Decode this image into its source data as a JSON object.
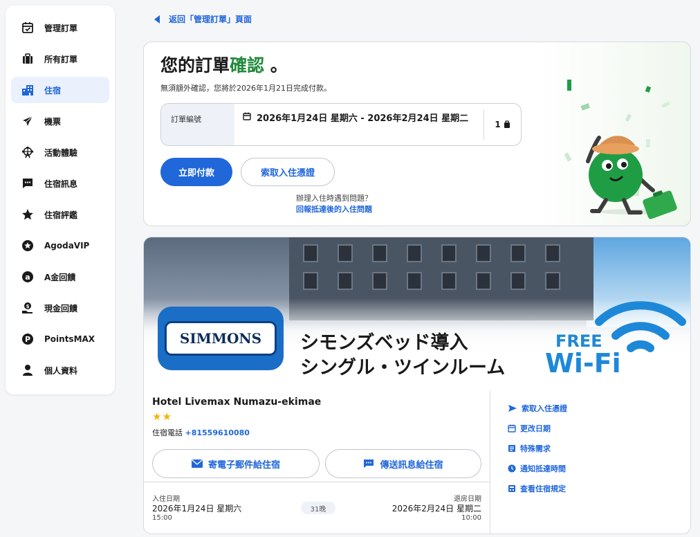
{
  "sidebar": {
    "items": [
      {
        "label": "管理訂單",
        "icon": "calendar-check-icon"
      },
      {
        "label": "所有訂單",
        "icon": "suitcase-icon"
      },
      {
        "label": "住宿",
        "icon": "building-icon",
        "active": true
      },
      {
        "label": "機票",
        "icon": "airplane-icon"
      },
      {
        "label": "活動體驗",
        "icon": "ferris-wheel-icon"
      },
      {
        "label": "住宿訊息",
        "icon": "chat-icon"
      },
      {
        "label": "住宿評鑑",
        "icon": "star-icon"
      },
      {
        "label": "AgodaVIP",
        "icon": "vip-star-icon"
      },
      {
        "label": "A金回饋",
        "icon": "agoda-cash-icon"
      },
      {
        "label": "現金回饋",
        "icon": "cashback-icon"
      },
      {
        "label": "PointsMAX",
        "icon": "pointsmax-icon"
      },
      {
        "label": "個人資料",
        "icon": "person-icon"
      }
    ]
  },
  "back_link": "返回「管理訂單」頁面",
  "confirm": {
    "title_prefix": "您的訂單",
    "title_highlight": "確認",
    "title_suffix": "。",
    "subtitle": "無須額外確認，您將於2026年1月21日完成付款。",
    "booking_label": "訂單編號",
    "dates": "2026年1月24日 星期六 - 2026年2月24日 星期二",
    "guests": "1",
    "pay_button": "立即付款",
    "voucher_button": "索取入住憑證",
    "help_question": "辦理入住時遇到問題？",
    "help_link": "回報抵達後的入住問題"
  },
  "hotel": {
    "banner_brand": "SIMMONS",
    "banner_line1": "シモンズベッド導入",
    "banner_line2": "シングル・ツインルーム",
    "banner_free": "FREE",
    "banner_wifi": "Wi-Fi",
    "name": "Hotel Livemax Numazu-ekimae",
    "stars": "★★",
    "star_rating": 2,
    "phone_label": "住宿電話",
    "phone_number": "+81559610080",
    "email_button": "寄電子郵件給住宿",
    "message_button": "傳送訊息給住宿",
    "checkin_label": "入住日期",
    "checkin_date": "2026年1月24日 星期六",
    "checkin_time": "15:00",
    "nights": "31晚",
    "checkout_label": "退房日期",
    "checkout_date": "2026年2月24日 星期二",
    "checkout_time": "10:00",
    "actions": [
      {
        "label": "索取入住憑證",
        "icon": "send-icon"
      },
      {
        "label": "更改日期",
        "icon": "calendar-icon"
      },
      {
        "label": "特殊需求",
        "icon": "request-icon"
      },
      {
        "label": "通知抵達時間",
        "icon": "clock-icon"
      },
      {
        "label": "查看住宿規定",
        "icon": "policy-icon"
      }
    ]
  },
  "colors": {
    "accent": "#2067da",
    "confirm_green": "#1f8a3a",
    "star": "#f4b400"
  }
}
